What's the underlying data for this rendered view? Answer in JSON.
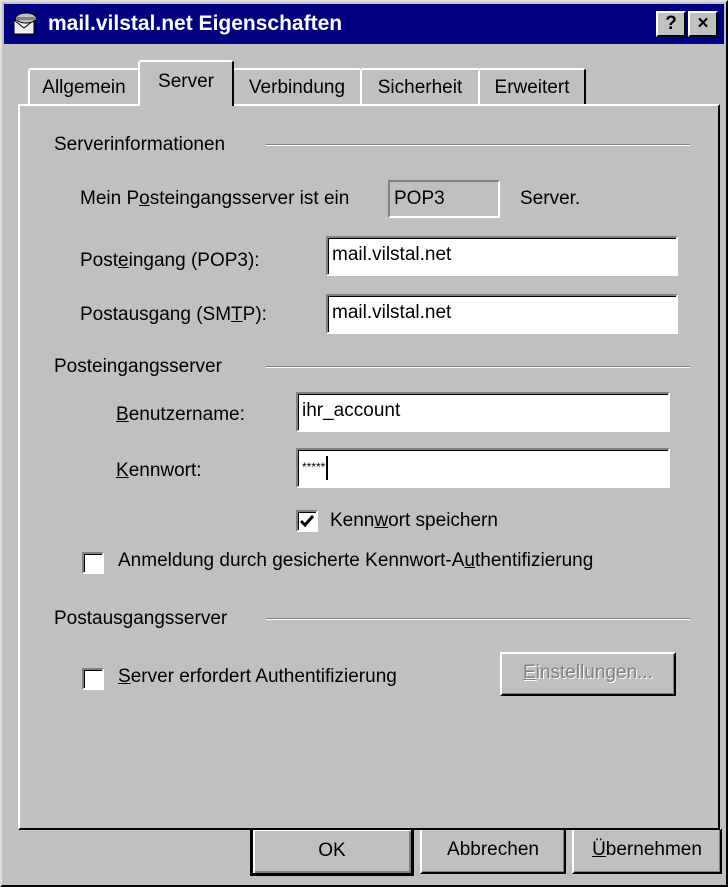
{
  "window": {
    "title": "mail.vilstal.net Eigenschaften",
    "help_btn": "?",
    "close_btn": "×"
  },
  "tabs": [
    {
      "label": "Allgemein"
    },
    {
      "label": "Server"
    },
    {
      "label": "Verbindung"
    },
    {
      "label": "Sicherheit"
    },
    {
      "label": "Erweitert"
    }
  ],
  "active_tab": "Server",
  "server_info": {
    "heading": "Serverinformationen",
    "incoming_type_prefix": "Mein P",
    "incoming_type_ul": "o",
    "incoming_type_rest": "steingangsserver ist ein",
    "incoming_type_value": "POP3",
    "incoming_type_suffix": "Server.",
    "incoming_label_a": "Post",
    "incoming_label_ul": "e",
    "incoming_label_b": "ingang (POP3):",
    "incoming_value": "mail.vilstal.net",
    "outgoing_label_a": "Postausgang (SM",
    "outgoing_label_ul": "T",
    "outgoing_label_b": "P):",
    "outgoing_value": "mail.vilstal.net"
  },
  "incoming_server": {
    "heading": "Posteingangsserver",
    "username_ul": "B",
    "username_rest": "enutzername:",
    "username_value": "ihr_account",
    "password_ul": "K",
    "password_rest": "ennwort:",
    "password_value": "*****",
    "save_pw_a": "Kenn",
    "save_pw_ul": "w",
    "save_pw_b": "ort speichern",
    "save_pw_checked": true,
    "spa_a": "Anmeldung durch gesicherte Kennwort-A",
    "spa_ul": "u",
    "spa_b": "thentifizierung",
    "spa_checked": false
  },
  "outgoing_server": {
    "heading": "Postausgangsserver",
    "auth_ul": "S",
    "auth_rest": "erver erfordert Authentifizierung",
    "auth_checked": false,
    "settings_ul": "E",
    "settings_rest": "instellungen..."
  },
  "buttons": {
    "ok": "OK",
    "cancel": "Abbrechen",
    "apply_ul": "Ü",
    "apply_rest": "bernehmen"
  },
  "colors": {
    "titlebar": "#000080",
    "face": "#c0c0c0"
  }
}
